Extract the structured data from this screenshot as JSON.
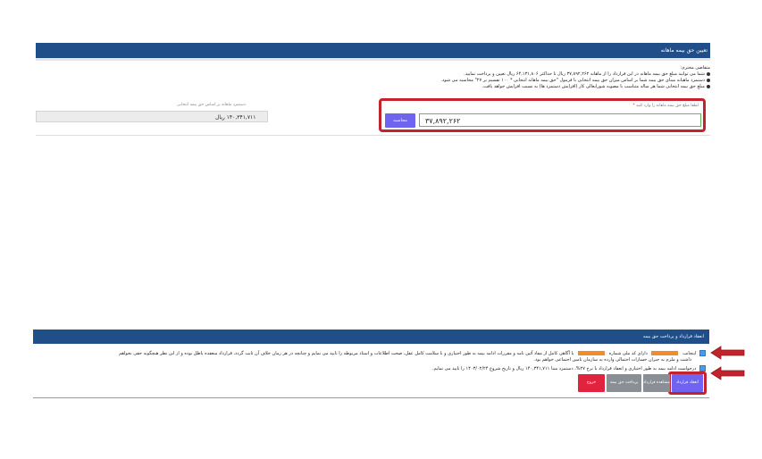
{
  "premium_panel": {
    "title": "تعیین حق بیمه ماهانه",
    "notes_heading": "متقاضی محترم:",
    "notes": [
      "شما می توانید مبلغ حق بیمه ماهانه در این قرارداد را از ماهانه ۳۷,۸۹۲,۲۶۲ ریال تا حداکثر ۶۴,۱۳۱,۸۰۶ ریال تعیین و پرداخت نمایید.",
      "دستمزد ماهیانه مبنای حق بیمه شما بر اساس میزان حق بیمه انتخابی با فرمول \"حق بیمه ماهانه انتخابی * ۱۰۰ تقسیم بر ۲۷\" محاسبه می شود.",
      "مبلغ حق بیمه انتخابی شما هر ساله متناسب با مصوبه شورایعالی کار (افزایش دستمزد ها) به نسبت افزایش خواهد یافت."
    ],
    "amount_label": "لطفا مبلغ حق بیمه ماهانه را وارد کنید",
    "required_mark": "*",
    "amount_value": "۳۷,۸۹۲,۲۶۲",
    "calculate_label": "محاسبه",
    "wage_label": "دستمزد ماهانه بر اساس حق بیمه انتخابی",
    "wage_value": "۱۴۰,۳۴۱,۷۱۱ ریال"
  },
  "contract_panel": {
    "title": "انعقاد قرارداد و پرداخت حق بیمه",
    "statement_1_a": "اینجانب",
    "statement_1_b": "دارای کد ملی شماره",
    "statement_1_c": "با آگاهی کامل از مفاد آئین نامه و مقررات ادامه بیمه به طور اختیاری و با سلامت کامل عقل، صحت اطلاعات و اسناد مربوطه را تایید می نمایم و چنانچه در هر زمان خلاف آن ثابت گردد، قرارداد منعقده باطل بوده و از این نظر هیچگونه حقی نخواهم",
    "statement_1_d": "داشت و ملزم به جبران خسارات احتمالی وارده به سازمان تامین اجتماعی خواهم بود.",
    "statement_2": "درخواست ادامه بیمه به طور اختیاری و انعقاد قرارداد با نرخ ۲۷%، دستمزد مبنا ۱۴۰,۳۴۱,۷۱۱ ریال و تاریخ شروع ۱۴۰۳/۰۲/۲۴ را تایید می نمایم.",
    "buttons": {
      "contract": "انعقاد قرارداد",
      "view_contract": "مشاهده قرارداد",
      "pay": "پرداخت حق بیمه",
      "exit": "خروج"
    }
  },
  "colors": {
    "header_blue": "#1f4e89",
    "highlight_red": "#c3232d",
    "primary_button": "#6f63f2",
    "exit_button": "#e0243d",
    "redaction_orange": "#f28b29"
  }
}
